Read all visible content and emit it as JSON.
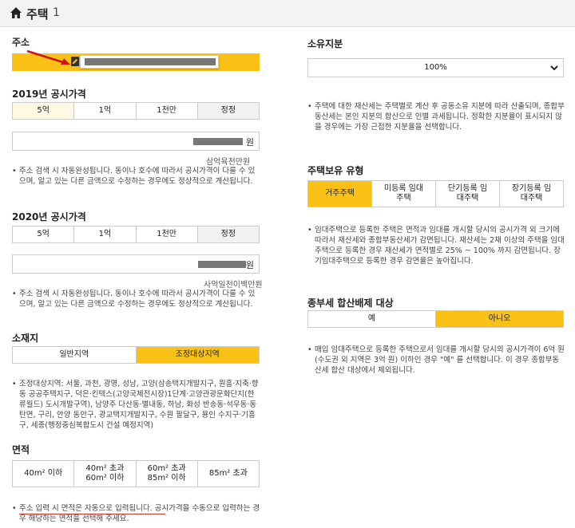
{
  "header": {
    "title": "주택",
    "count": "1"
  },
  "address": {
    "label": "주소"
  },
  "price2019": {
    "label": "2019년 공시가격",
    "options": [
      "5억",
      "1억",
      "1천만",
      "정정"
    ],
    "unit": "원",
    "hint": "삼억육천만원",
    "note": "주소 검색 시 자동완성됩니다. 동이나 호수에 따라서 공시가격이 다를 수 있으며, 알고 있는 다른 금액으로 수정하는 경우에도 정상적으로 계산됩니다."
  },
  "price2020": {
    "label": "2020년 공시가격",
    "options": [
      "5억",
      "1억",
      "1천만",
      "정정"
    ],
    "unit": "원",
    "hint": "사억일천이백만원",
    "note": "주소 검색 시 자동완성됩니다. 동이나 호수에 따라서 공시가격이 다를 수 있으며, 알고 있는 다른 금액으로 수정하는 경우에도 정상적으로 계산됩니다."
  },
  "location": {
    "label": "소재지",
    "options": [
      "일반지역",
      "조정대상지역"
    ],
    "selected": "조정대상지역",
    "note": "조정대상지역: 서울, 과천, 광명, 성남, 고양(삼송택지개발지구, 원흥·지축·향동 공공주택지구, 덕은·킨텍스(고양국제전시장)1단계·고양관광문화단지(한류월드) 도시개발구역), 남양주 다산동·별내동, 하남, 화성 반송동·석우동·동탄면, 구리, 안양 동안구, 광교택지개발지구, 수원 팔달구, 용인 수지구·기흥구, 세종(행정중심복합도시 건설 예정지역)"
  },
  "area": {
    "label": "면적",
    "options": [
      {
        "l1": "40m² 이하",
        "l2": ""
      },
      {
        "l1": "40m² 초과",
        "l2": "60m² 이하"
      },
      {
        "l1": "60m² 초과",
        "l2": "85m² 이하"
      },
      {
        "l1": "85m² 초과",
        "l2": ""
      }
    ],
    "note": "주소 입력 시 면적은 자동으로 입력됩니다. 공시가격을 수동으로 입력하는 경우 해당하는 면적을 선택해 주세요."
  },
  "ownership": {
    "label": "소유지분",
    "value": "100%",
    "note": "주택에 대한 재산세는 주택별로 계산 후 공동소유 지분에 따라 산출되며, 종합부동산세는 본인 지분의 합산으로 인별 과세됩니다. 정확한 지분율이 표시되지 않을 경우에는 가장 근접한 지분율을 선택합니다."
  },
  "holding": {
    "label": "주택보유 유형",
    "options": [
      {
        "l1": "거주주택",
        "l2": ""
      },
      {
        "l1": "미등록 임대",
        "l2": "주택"
      },
      {
        "l1": "단기등록 임",
        "l2": "대주택"
      },
      {
        "l1": "장기등록 임",
        "l2": "대주택"
      }
    ],
    "selected": "거주주택",
    "note": "임대주택으로 등록한 주택은 면적과 임대를 개시할 당시의 공시가격 외 크기에 따라서 재산세와 종합부동산세가 감면됩니다. 재산세는 2채 이상의 주택을 임대주택으로 등록한 경우 재산세가 면적별로 25% ~ 100% 까지 감면됩니다. 장기임대주택으로 등록한 경우 감면율은 높아집니다."
  },
  "exclusion": {
    "label": "종부세 합산배제 대상",
    "options": [
      "예",
      "아니오"
    ],
    "selected": "아니오",
    "note": "매입 임대주택으로 등록한 주택으로서 임대를 개시할 당시의 공시가격이 6억 원(수도권 외 지역은 3억 원) 이하인 경우 \"예\" 를 선택합니다. 이 경우 종합부동산세 합산 대상에서 제외됩니다."
  },
  "colors": {
    "accent": "#f9c115",
    "annotation": "#d0121b"
  },
  "icons": {
    "home": "home-icon",
    "edit": "pencil-icon",
    "dropdown": "chevron-down-icon"
  }
}
